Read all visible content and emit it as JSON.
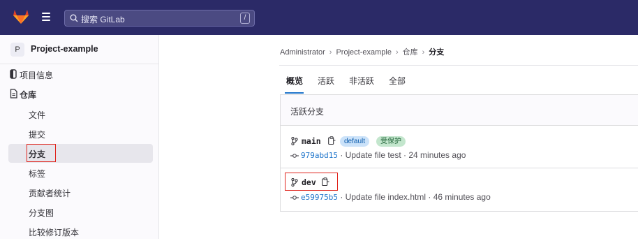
{
  "search": {
    "placeholder": "搜索 GitLab",
    "shortcut": "/"
  },
  "project": {
    "avatar_letter": "P",
    "name": "Project-example"
  },
  "sidebar": {
    "items": [
      {
        "label": "项目信息",
        "icon": "info-icon"
      },
      {
        "label": "仓库",
        "icon": "document-icon"
      },
      {
        "label": "文件"
      },
      {
        "label": "提交"
      },
      {
        "label": "分支",
        "active": true
      },
      {
        "label": "标签"
      },
      {
        "label": "贡献者统计"
      },
      {
        "label": "分支图"
      },
      {
        "label": "比较修订版本"
      }
    ]
  },
  "breadcrumb": {
    "items": [
      "Administrator",
      "Project-example",
      "仓库"
    ],
    "current": "分支",
    "separator": "›"
  },
  "tabs": [
    {
      "label": "概览",
      "active": true
    },
    {
      "label": "活跃"
    },
    {
      "label": "非活跃"
    },
    {
      "label": "全部"
    }
  ],
  "panel": {
    "title": "活跃分支",
    "branches": [
      {
        "name": "main",
        "badges": [
          "default",
          "受保护"
        ],
        "sha": "979abd15",
        "message": " · Update file test · 24 minutes ago"
      },
      {
        "name": "dev",
        "badges": [],
        "sha": "e59975b5",
        "message": " · Update file index.html · 46 minutes ago"
      }
    ]
  },
  "colors": {
    "topbar": "#2b2a67",
    "link": "#1f75cb",
    "highlight": "#e0231c"
  }
}
